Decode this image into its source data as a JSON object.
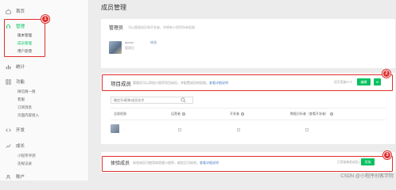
{
  "sidebar": {
    "home": "首页",
    "manage": "管理",
    "manage_sub": [
      "版本管理",
      "成员管理",
      "用户反馈"
    ],
    "stats": "统计",
    "features": "功能",
    "features_sub": [
      "微信搜一搜",
      "客服",
      "订阅消息",
      "页面内容接入"
    ],
    "dev": "开发",
    "growth": "成长",
    "growth_sub": [
      "小程序评测",
      "违规记录"
    ],
    "more": "账户"
  },
  "badges": [
    "1",
    "2",
    "3"
  ],
  "page_title": "成员管理",
  "admin": {
    "title": "管理员",
    "desc": "可以管理成员和开发者，并拥有小程序所有权限",
    "name": "admin",
    "tag": "修改",
    "role": "管理员",
    "extra": "·"
  },
  "project": {
    "title": "项目成员",
    "desc": "管理员可以添加小程序项目成员，并配置成员的权限。",
    "link": "查看详细说明",
    "count": "还可添加97人",
    "edit_button": "编辑",
    "search_placeholder": "微信号/昵称/成员名字",
    "columns": [
      "全部权限",
      "运营者",
      "开发者",
      "数据分析者（查看开发者）"
    ],
    "row_name": "···"
  },
  "experience": {
    "title": "体验成员",
    "desc": "体验成员可使用体验版小程序，绑定后可体验。",
    "link": "查看详细说明",
    "count": "已添加体验成员1个",
    "add_button": "添加"
  },
  "watermark": "CSDN @小程序创客学院"
}
